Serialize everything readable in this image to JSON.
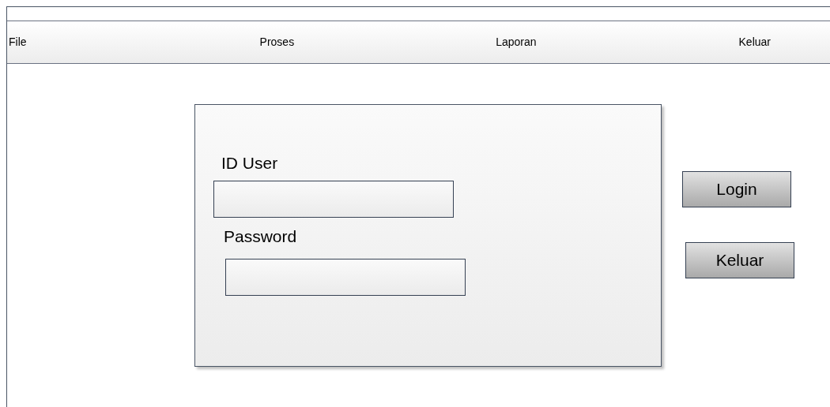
{
  "menu_bar": {
    "items": [
      {
        "label": "File"
      },
      {
        "label": "Proses"
      },
      {
        "label": "Laporan"
      },
      {
        "label": "Keluar"
      }
    ]
  },
  "login_form": {
    "fields": [
      {
        "label": "ID User"
      },
      {
        "label": "Password"
      }
    ]
  },
  "buttons": [
    {
      "label": "Login"
    },
    {
      "label": "Keluar"
    }
  ]
}
